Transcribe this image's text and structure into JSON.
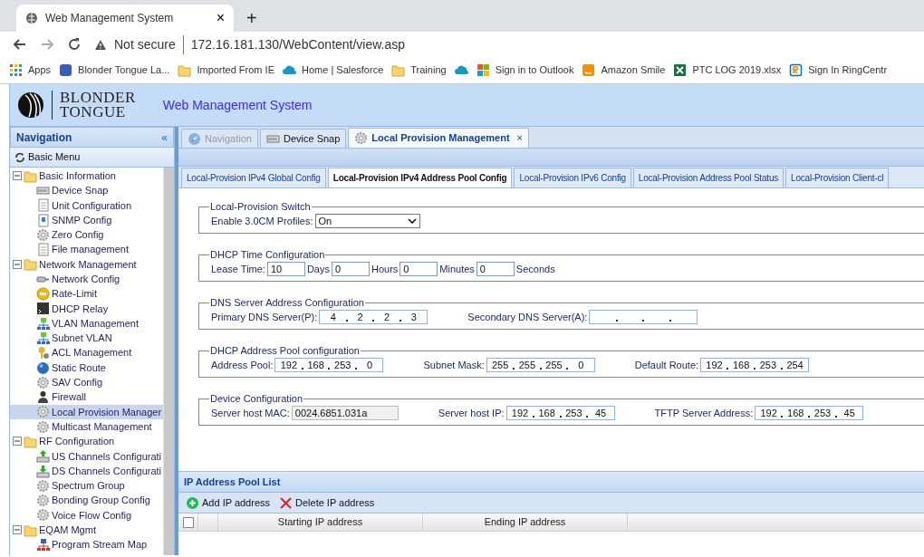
{
  "browser": {
    "tab_title": "Web Management System",
    "tab_close": "×",
    "new_tab": "+",
    "security": "Not secure",
    "url": "172.16.181.130/WebContent/view.asp",
    "bookmarks": [
      {
        "kind": "apps",
        "label": "Apps"
      },
      {
        "kind": "square",
        "label": "Blonder Tongue La..."
      },
      {
        "kind": "folder",
        "label": "Imported From IE"
      },
      {
        "kind": "cloud",
        "label": "Home | Salesforce"
      },
      {
        "kind": "folder",
        "label": "Training"
      },
      {
        "kind": "cloud"
      },
      {
        "kind": "windows",
        "label": "Sign in to Outlook"
      },
      {
        "kind": "amazon",
        "label": "Amazon Smile"
      },
      {
        "kind": "excel",
        "label": "PTC LOG 2019.xlsx"
      },
      {
        "kind": "ring",
        "label": "Sign In RingCentr"
      }
    ]
  },
  "header": {
    "logo": [
      "BLONDER",
      "TONGUE"
    ],
    "title": "Web Management System"
  },
  "navigation": {
    "title": "Navigation",
    "collapse": "«",
    "menu": "Basic Menu",
    "tree": [
      {
        "label": "Basic Information",
        "expanded": true,
        "children": [
          {
            "label": "Device Snap",
            "kind": "device",
            "selected": false
          },
          {
            "label": "Unit Configuration",
            "kind": "page",
            "selected": false
          },
          {
            "label": "SNMP Config",
            "kind": "snmp",
            "selected": false
          },
          {
            "label": "Zero Config",
            "kind": "gear",
            "selected": false
          },
          {
            "label": "File management",
            "kind": "page",
            "selected": false
          }
        ]
      },
      {
        "label": "Network Management",
        "expanded": true,
        "children": [
          {
            "label": "Network Config",
            "kind": "cable",
            "selected": false
          },
          {
            "label": "Rate-Limit",
            "kind": "rate",
            "selected": false
          },
          {
            "label": "DHCP Relay",
            "kind": "terminal",
            "selected": false
          },
          {
            "label": "VLAN Management",
            "kind": "lan",
            "selected": false
          },
          {
            "label": "Subnet VLAN",
            "kind": "lan",
            "selected": false
          },
          {
            "label": "ACL Management",
            "kind": "key",
            "selected": false
          },
          {
            "label": "Static Route",
            "kind": "globe",
            "selected": false
          },
          {
            "label": "SAV Config",
            "kind": "gear",
            "selected": false
          },
          {
            "label": "Firewall",
            "kind": "person",
            "selected": false
          },
          {
            "label": "Local Provision Manager",
            "kind": "gear",
            "selected": true
          },
          {
            "label": "Multicast Management",
            "kind": "gear",
            "selected": false
          }
        ]
      },
      {
        "label": "RF Configuration",
        "expanded": true,
        "children": [
          {
            "label": "US Channels Configurati",
            "kind": "upload",
            "selected": false
          },
          {
            "label": "DS Channels Configurati",
            "kind": "download",
            "selected": false
          },
          {
            "label": "Spectrum Group",
            "kind": "gear",
            "selected": false
          },
          {
            "label": "Bonding Group Config",
            "kind": "gear",
            "selected": false
          },
          {
            "label": "Voice Flow Config",
            "kind": "gear",
            "selected": false
          }
        ]
      },
      {
        "label": "EQAM Mgmt",
        "expanded": true,
        "children": [
          {
            "label": "Program Stream Map",
            "kind": "lanred",
            "selected": false
          }
        ]
      }
    ]
  },
  "tabs": [
    {
      "label": "Navigation",
      "kind": "compass",
      "selected": false,
      "disabled": true
    },
    {
      "label": "Device Snap",
      "kind": "device",
      "selected": false,
      "disabled": false
    },
    {
      "label": "Local Provision Management",
      "kind": "gear",
      "selected": true,
      "disabled": false,
      "close": "×"
    }
  ],
  "subtabs": [
    {
      "label": "Local-Provision IPv4 Global Config",
      "selected": false
    },
    {
      "label": "Local-Provision IPv4 Address Pool Config",
      "selected": true
    },
    {
      "label": "Local-Provision IPv6 Config",
      "selected": false
    },
    {
      "label": "Local-Provision Address Pool Status",
      "selected": false
    },
    {
      "label": "Local-Provision Client-cl",
      "selected": false
    }
  ],
  "sections": [
    {
      "legend": "Local-Provision Switch",
      "items": [
        {
          "kind": "label",
          "text": "Enable 3.0CM Profiles:"
        },
        {
          "kind": "select",
          "value": "On"
        }
      ]
    },
    {
      "legend": "DHCP Time Configuration",
      "items": [
        {
          "kind": "label",
          "text": "Lease Time:"
        },
        {
          "kind": "text",
          "value": "10"
        },
        {
          "kind": "label",
          "text": "Days"
        },
        {
          "kind": "text",
          "value": "0"
        },
        {
          "kind": "label",
          "text": "Hours"
        },
        {
          "kind": "text",
          "value": "0"
        },
        {
          "kind": "label",
          "text": "Minutes"
        },
        {
          "kind": "text",
          "value": "0"
        },
        {
          "kind": "label",
          "text": "Seconds"
        }
      ]
    },
    {
      "legend": "DNS Server Address Configuration",
      "items": [
        {
          "kind": "label",
          "text": "Primary DNS Server(P):"
        },
        {
          "kind": "ip",
          "octets": [
            "4",
            "2",
            "2",
            "3"
          ]
        },
        {
          "kind": "gap"
        },
        {
          "kind": "label",
          "text": "Secondary DNS Server(A):"
        },
        {
          "kind": "ip"
        }
      ]
    },
    {
      "legend": "DHCP Address Pool configuration",
      "items": [
        {
          "kind": "label",
          "text": "Address Pool:"
        },
        {
          "kind": "ip",
          "octets": [
            "192",
            "168",
            "253",
            "0"
          ]
        },
        {
          "kind": "gap"
        },
        {
          "kind": "label",
          "text": "Subnet Mask:"
        },
        {
          "kind": "ip",
          "octets": [
            "255",
            "255",
            "255",
            "0"
          ]
        },
        {
          "kind": "gap"
        },
        {
          "kind": "label",
          "text": "Default Route:"
        },
        {
          "kind": "ip",
          "octets": [
            "192",
            "168",
            "253",
            "254"
          ]
        }
      ]
    },
    {
      "legend": "Device Configuration",
      "items": [
        {
          "kind": "label",
          "text": "Server host MAC:"
        },
        {
          "kind": "readonly",
          "value": "0024.6851.031a"
        },
        {
          "kind": "gap"
        },
        {
          "kind": "label",
          "text": "Server host IP:"
        },
        {
          "kind": "ip",
          "octets": [
            "192",
            "168",
            "253",
            "45"
          ]
        },
        {
          "kind": "gap"
        },
        {
          "kind": "label",
          "text": "TFTP Server Address:"
        },
        {
          "kind": "ip",
          "octets": [
            "192",
            "168",
            "253",
            "45"
          ]
        }
      ]
    }
  ],
  "pool_list": {
    "title": "IP Address Pool List",
    "actions": [
      {
        "kind": "add",
        "label": "Add IP address"
      },
      {
        "kind": "delete",
        "label": "Delete IP address"
      }
    ],
    "select_all": {
      "checked": false
    },
    "columns": [
      "Starting IP address",
      "Ending IP address"
    ]
  }
}
